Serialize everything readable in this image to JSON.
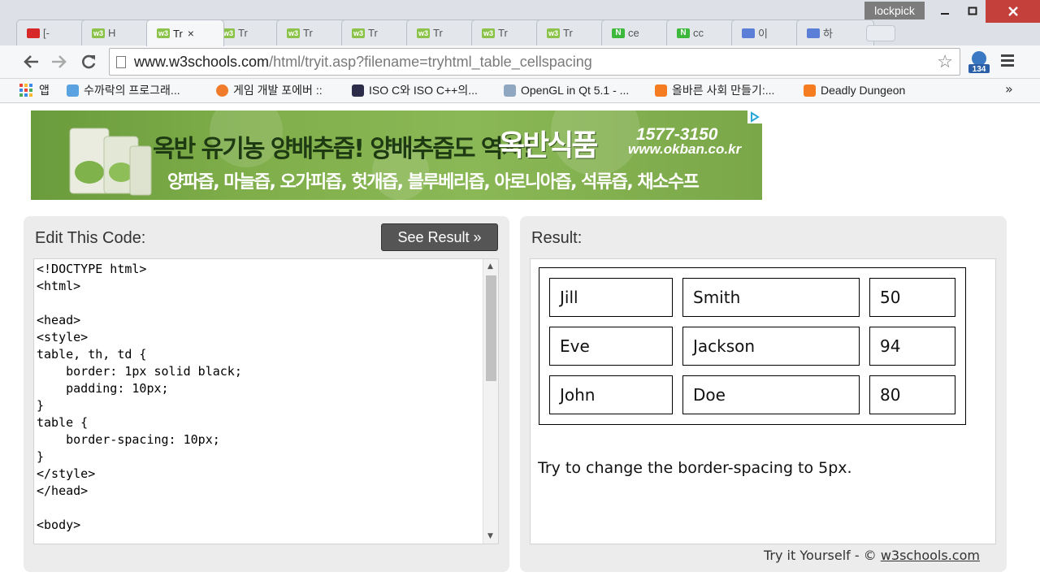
{
  "window": {
    "user_badge": "lockpick",
    "tabs": [
      {
        "label": "[-",
        "icon": "youtube-icon"
      },
      {
        "label": "H",
        "icon": "w3schools-icon"
      },
      {
        "label": "Tr",
        "icon": "w3schools-icon",
        "active": true
      },
      {
        "label": "Tr",
        "icon": "w3schools-icon"
      },
      {
        "label": "Tr",
        "icon": "w3schools-icon"
      },
      {
        "label": "Tr",
        "icon": "w3schools-icon"
      },
      {
        "label": "Tr",
        "icon": "w3schools-icon"
      },
      {
        "label": "Tr",
        "icon": "w3schools-icon"
      },
      {
        "label": "Tr",
        "icon": "w3schools-icon"
      },
      {
        "label": "ce",
        "icon": "naver-icon"
      },
      {
        "label": "cc",
        "icon": "naver-icon"
      },
      {
        "label": "이",
        "icon": "extension-icon"
      },
      {
        "label": "하",
        "icon": "extension-icon"
      }
    ],
    "tab_close": "×",
    "fav_w3": "w3",
    "fav_n": "N"
  },
  "toolbar": {
    "url_host": "www.w3schools.com",
    "url_path": "/html/tryit.asp?filename=tryhtml_table_cellspacing",
    "extension_badge": "134"
  },
  "bookmarks": [
    {
      "label": "앱",
      "color": "#e8453c"
    },
    {
      "label": "수까락의 프로그래...",
      "color": "#5aa3e0"
    },
    {
      "label": "게임 개발 포에버 ::",
      "color": "#f07b2a"
    },
    {
      "label": "ISO C와 ISO C++의...",
      "color": "#2d2d4a"
    },
    {
      "label": "OpenGL in Qt 5.1 - ...",
      "color": "#8fa7c0"
    },
    {
      "label": "올바른 사회 만들기:...",
      "color": "#f57c20"
    },
    {
      "label": "Deadly Dungeon",
      "color": "#f57c20"
    }
  ],
  "bookmarks_more": "»",
  "ad": {
    "line1": "옥반 유기농 양배추즙! 양배추즙도 역시!",
    "brand": "옥반식품",
    "phone": "1577-3150",
    "site": "www.okban.co.kr",
    "line2": "양파즙, 마늘즙, 오가피즙, 헛개즙, 블루베리즙, 아로니아즙, 석류즙, 채소수프"
  },
  "editor": {
    "title": "Edit This Code:",
    "button": "See Result »",
    "code_lines": [
      "<!DOCTYPE html>",
      "<html>",
      "",
      "<head>",
      "<style>",
      "table, th, td {",
      "    border: 1px solid black;",
      "    padding: 10px;",
      "}",
      "table {",
      "    border-spacing: 10px;",
      "}",
      "</style>",
      "</head>",
      "",
      "<body>"
    ]
  },
  "result": {
    "title": "Result:",
    "rows": [
      [
        "Jill",
        "Smith",
        "50"
      ],
      [
        "Eve",
        "Jackson",
        "94"
      ],
      [
        "John",
        "Doe",
        "80"
      ]
    ],
    "note": "Try to change the border-spacing to 5px.",
    "footer_prefix": "Try it Yourself - ©",
    "footer_link": "w3schools.com"
  },
  "colors": {
    "close_button": "#c4413b",
    "see_result_bg": "#555555",
    "panel_bg": "#ececec",
    "ad_green": "#7fae4a"
  }
}
